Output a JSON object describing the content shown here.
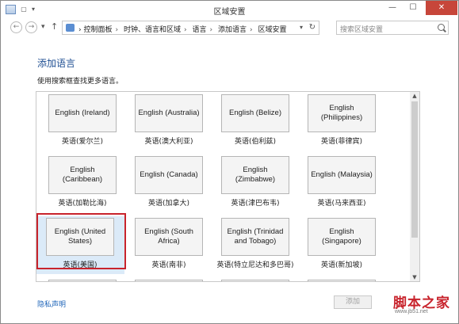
{
  "window": {
    "title": "区域安置",
    "minimize": "—",
    "maximize": "☐",
    "close": "✕"
  },
  "nav": {
    "back": "←",
    "forward": "→",
    "dropdown": "▾",
    "up": "↑",
    "breadcrumbs": [
      "控制面板",
      "时钟、语言和区域",
      "语言",
      "添加语言",
      "区域安置"
    ],
    "address_dropdown": "▾",
    "refresh": "↻",
    "search_placeholder": "搜索区域安置"
  },
  "page": {
    "heading": "添加语言",
    "instruction": "使用搜索框查找更多语言。"
  },
  "languages": [
    {
      "card": "English (Ireland)",
      "caption": "英语(爱尔兰)"
    },
    {
      "card": "English (Australia)",
      "caption": "英语(澳大利亚)"
    },
    {
      "card": "English (Belize)",
      "caption": "英语(伯利兹)"
    },
    {
      "card": "English (Philippines)",
      "caption": "英语(菲律宾)"
    },
    {
      "card": "English (Caribbean)",
      "caption": "英语(加勒比海)"
    },
    {
      "card": "English (Canada)",
      "caption": "英语(加拿大)"
    },
    {
      "card": "English (Zimbabwe)",
      "caption": "英语(津巴布韦)"
    },
    {
      "card": "English (Malaysia)",
      "caption": "英语(马来西亚)"
    },
    {
      "card": "English (United States)",
      "caption": "英语(美国)"
    },
    {
      "card": "English (South Africa)",
      "caption": "英语(南非)"
    },
    {
      "card": "English (Trinidad and Tobago)",
      "caption": "英语(特立尼达和多巴哥)"
    },
    {
      "card": "English (Singapore)",
      "caption": "英语(新加坡)"
    }
  ],
  "selected_language": "English (United States)",
  "scroll": {
    "up": "▲",
    "down": "▼"
  },
  "footer": {
    "privacy_link": "隐私声明",
    "add_button": "添加"
  },
  "watermark": {
    "text": "脚本之家",
    "url_text": "www.jb51.net"
  },
  "colors": {
    "heading": "#1e4e92",
    "link": "#1e64b8",
    "selection_border": "#c8232c",
    "selected_bg": "#dbeaf8"
  }
}
